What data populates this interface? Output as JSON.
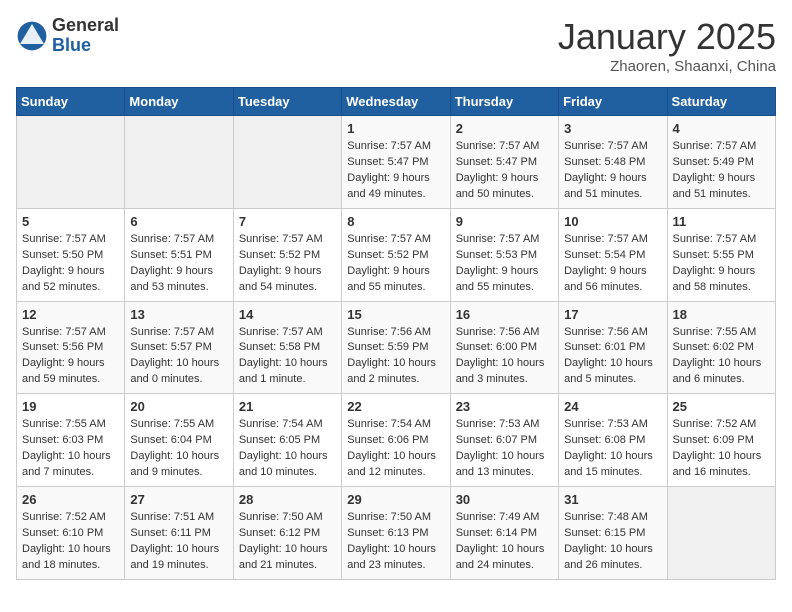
{
  "header": {
    "logo_line1": "General",
    "logo_line2": "Blue",
    "month": "January 2025",
    "location": "Zhaoren, Shaanxi, China"
  },
  "weekdays": [
    "Sunday",
    "Monday",
    "Tuesday",
    "Wednesday",
    "Thursday",
    "Friday",
    "Saturday"
  ],
  "weeks": [
    [
      {
        "day": "",
        "info": ""
      },
      {
        "day": "",
        "info": ""
      },
      {
        "day": "",
        "info": ""
      },
      {
        "day": "1",
        "info": "Sunrise: 7:57 AM\nSunset: 5:47 PM\nDaylight: 9 hours\nand 49 minutes."
      },
      {
        "day": "2",
        "info": "Sunrise: 7:57 AM\nSunset: 5:47 PM\nDaylight: 9 hours\nand 50 minutes."
      },
      {
        "day": "3",
        "info": "Sunrise: 7:57 AM\nSunset: 5:48 PM\nDaylight: 9 hours\nand 51 minutes."
      },
      {
        "day": "4",
        "info": "Sunrise: 7:57 AM\nSunset: 5:49 PM\nDaylight: 9 hours\nand 51 minutes."
      }
    ],
    [
      {
        "day": "5",
        "info": "Sunrise: 7:57 AM\nSunset: 5:50 PM\nDaylight: 9 hours\nand 52 minutes."
      },
      {
        "day": "6",
        "info": "Sunrise: 7:57 AM\nSunset: 5:51 PM\nDaylight: 9 hours\nand 53 minutes."
      },
      {
        "day": "7",
        "info": "Sunrise: 7:57 AM\nSunset: 5:52 PM\nDaylight: 9 hours\nand 54 minutes."
      },
      {
        "day": "8",
        "info": "Sunrise: 7:57 AM\nSunset: 5:52 PM\nDaylight: 9 hours\nand 55 minutes."
      },
      {
        "day": "9",
        "info": "Sunrise: 7:57 AM\nSunset: 5:53 PM\nDaylight: 9 hours\nand 55 minutes."
      },
      {
        "day": "10",
        "info": "Sunrise: 7:57 AM\nSunset: 5:54 PM\nDaylight: 9 hours\nand 56 minutes."
      },
      {
        "day": "11",
        "info": "Sunrise: 7:57 AM\nSunset: 5:55 PM\nDaylight: 9 hours\nand 58 minutes."
      }
    ],
    [
      {
        "day": "12",
        "info": "Sunrise: 7:57 AM\nSunset: 5:56 PM\nDaylight: 9 hours\nand 59 minutes."
      },
      {
        "day": "13",
        "info": "Sunrise: 7:57 AM\nSunset: 5:57 PM\nDaylight: 10 hours\nand 0 minutes."
      },
      {
        "day": "14",
        "info": "Sunrise: 7:57 AM\nSunset: 5:58 PM\nDaylight: 10 hours\nand 1 minute."
      },
      {
        "day": "15",
        "info": "Sunrise: 7:56 AM\nSunset: 5:59 PM\nDaylight: 10 hours\nand 2 minutes."
      },
      {
        "day": "16",
        "info": "Sunrise: 7:56 AM\nSunset: 6:00 PM\nDaylight: 10 hours\nand 3 minutes."
      },
      {
        "day": "17",
        "info": "Sunrise: 7:56 AM\nSunset: 6:01 PM\nDaylight: 10 hours\nand 5 minutes."
      },
      {
        "day": "18",
        "info": "Sunrise: 7:55 AM\nSunset: 6:02 PM\nDaylight: 10 hours\nand 6 minutes."
      }
    ],
    [
      {
        "day": "19",
        "info": "Sunrise: 7:55 AM\nSunset: 6:03 PM\nDaylight: 10 hours\nand 7 minutes."
      },
      {
        "day": "20",
        "info": "Sunrise: 7:55 AM\nSunset: 6:04 PM\nDaylight: 10 hours\nand 9 minutes."
      },
      {
        "day": "21",
        "info": "Sunrise: 7:54 AM\nSunset: 6:05 PM\nDaylight: 10 hours\nand 10 minutes."
      },
      {
        "day": "22",
        "info": "Sunrise: 7:54 AM\nSunset: 6:06 PM\nDaylight: 10 hours\nand 12 minutes."
      },
      {
        "day": "23",
        "info": "Sunrise: 7:53 AM\nSunset: 6:07 PM\nDaylight: 10 hours\nand 13 minutes."
      },
      {
        "day": "24",
        "info": "Sunrise: 7:53 AM\nSunset: 6:08 PM\nDaylight: 10 hours\nand 15 minutes."
      },
      {
        "day": "25",
        "info": "Sunrise: 7:52 AM\nSunset: 6:09 PM\nDaylight: 10 hours\nand 16 minutes."
      }
    ],
    [
      {
        "day": "26",
        "info": "Sunrise: 7:52 AM\nSunset: 6:10 PM\nDaylight: 10 hours\nand 18 minutes."
      },
      {
        "day": "27",
        "info": "Sunrise: 7:51 AM\nSunset: 6:11 PM\nDaylight: 10 hours\nand 19 minutes."
      },
      {
        "day": "28",
        "info": "Sunrise: 7:50 AM\nSunset: 6:12 PM\nDaylight: 10 hours\nand 21 minutes."
      },
      {
        "day": "29",
        "info": "Sunrise: 7:50 AM\nSunset: 6:13 PM\nDaylight: 10 hours\nand 23 minutes."
      },
      {
        "day": "30",
        "info": "Sunrise: 7:49 AM\nSunset: 6:14 PM\nDaylight: 10 hours\nand 24 minutes."
      },
      {
        "day": "31",
        "info": "Sunrise: 7:48 AM\nSunset: 6:15 PM\nDaylight: 10 hours\nand 26 minutes."
      },
      {
        "day": "",
        "info": ""
      }
    ]
  ]
}
